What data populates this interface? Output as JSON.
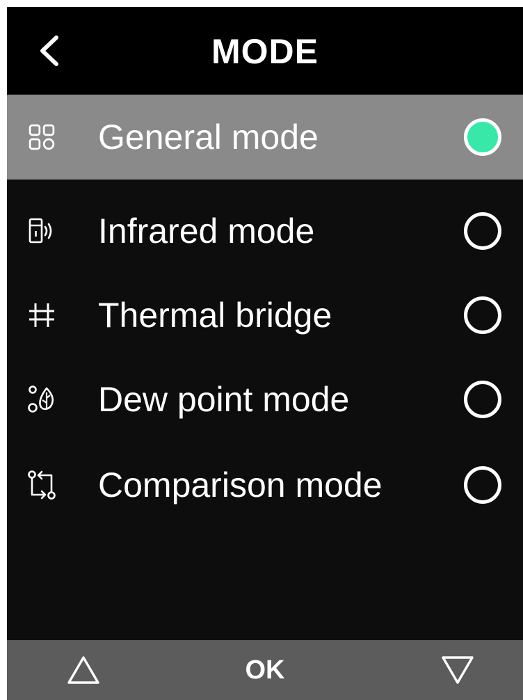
{
  "header": {
    "title": "MODE",
    "back_icon": "chevron-left-icon"
  },
  "modes": [
    {
      "label": "General mode",
      "icon": "grid-icon",
      "selected": true
    },
    {
      "label": "Infrared mode",
      "icon": "infrared-device-icon",
      "selected": false
    },
    {
      "label": "Thermal bridge",
      "icon": "thermal-bridge-icon",
      "selected": false
    },
    {
      "label": "Dew point mode",
      "icon": "dew-point-icon",
      "selected": false
    },
    {
      "label": "Comparison mode",
      "icon": "compare-icon",
      "selected": false
    }
  ],
  "footer": {
    "up_icon": "triangle-up-icon",
    "ok_label": "OK",
    "down_icon": "triangle-down-icon"
  },
  "colors": {
    "background": "#0d0d0d",
    "header": "#000000",
    "selected_row": "#8a8a8a",
    "radio_active": "#37e8a8",
    "footer": "#5c5c5c",
    "text": "#ffffff"
  }
}
